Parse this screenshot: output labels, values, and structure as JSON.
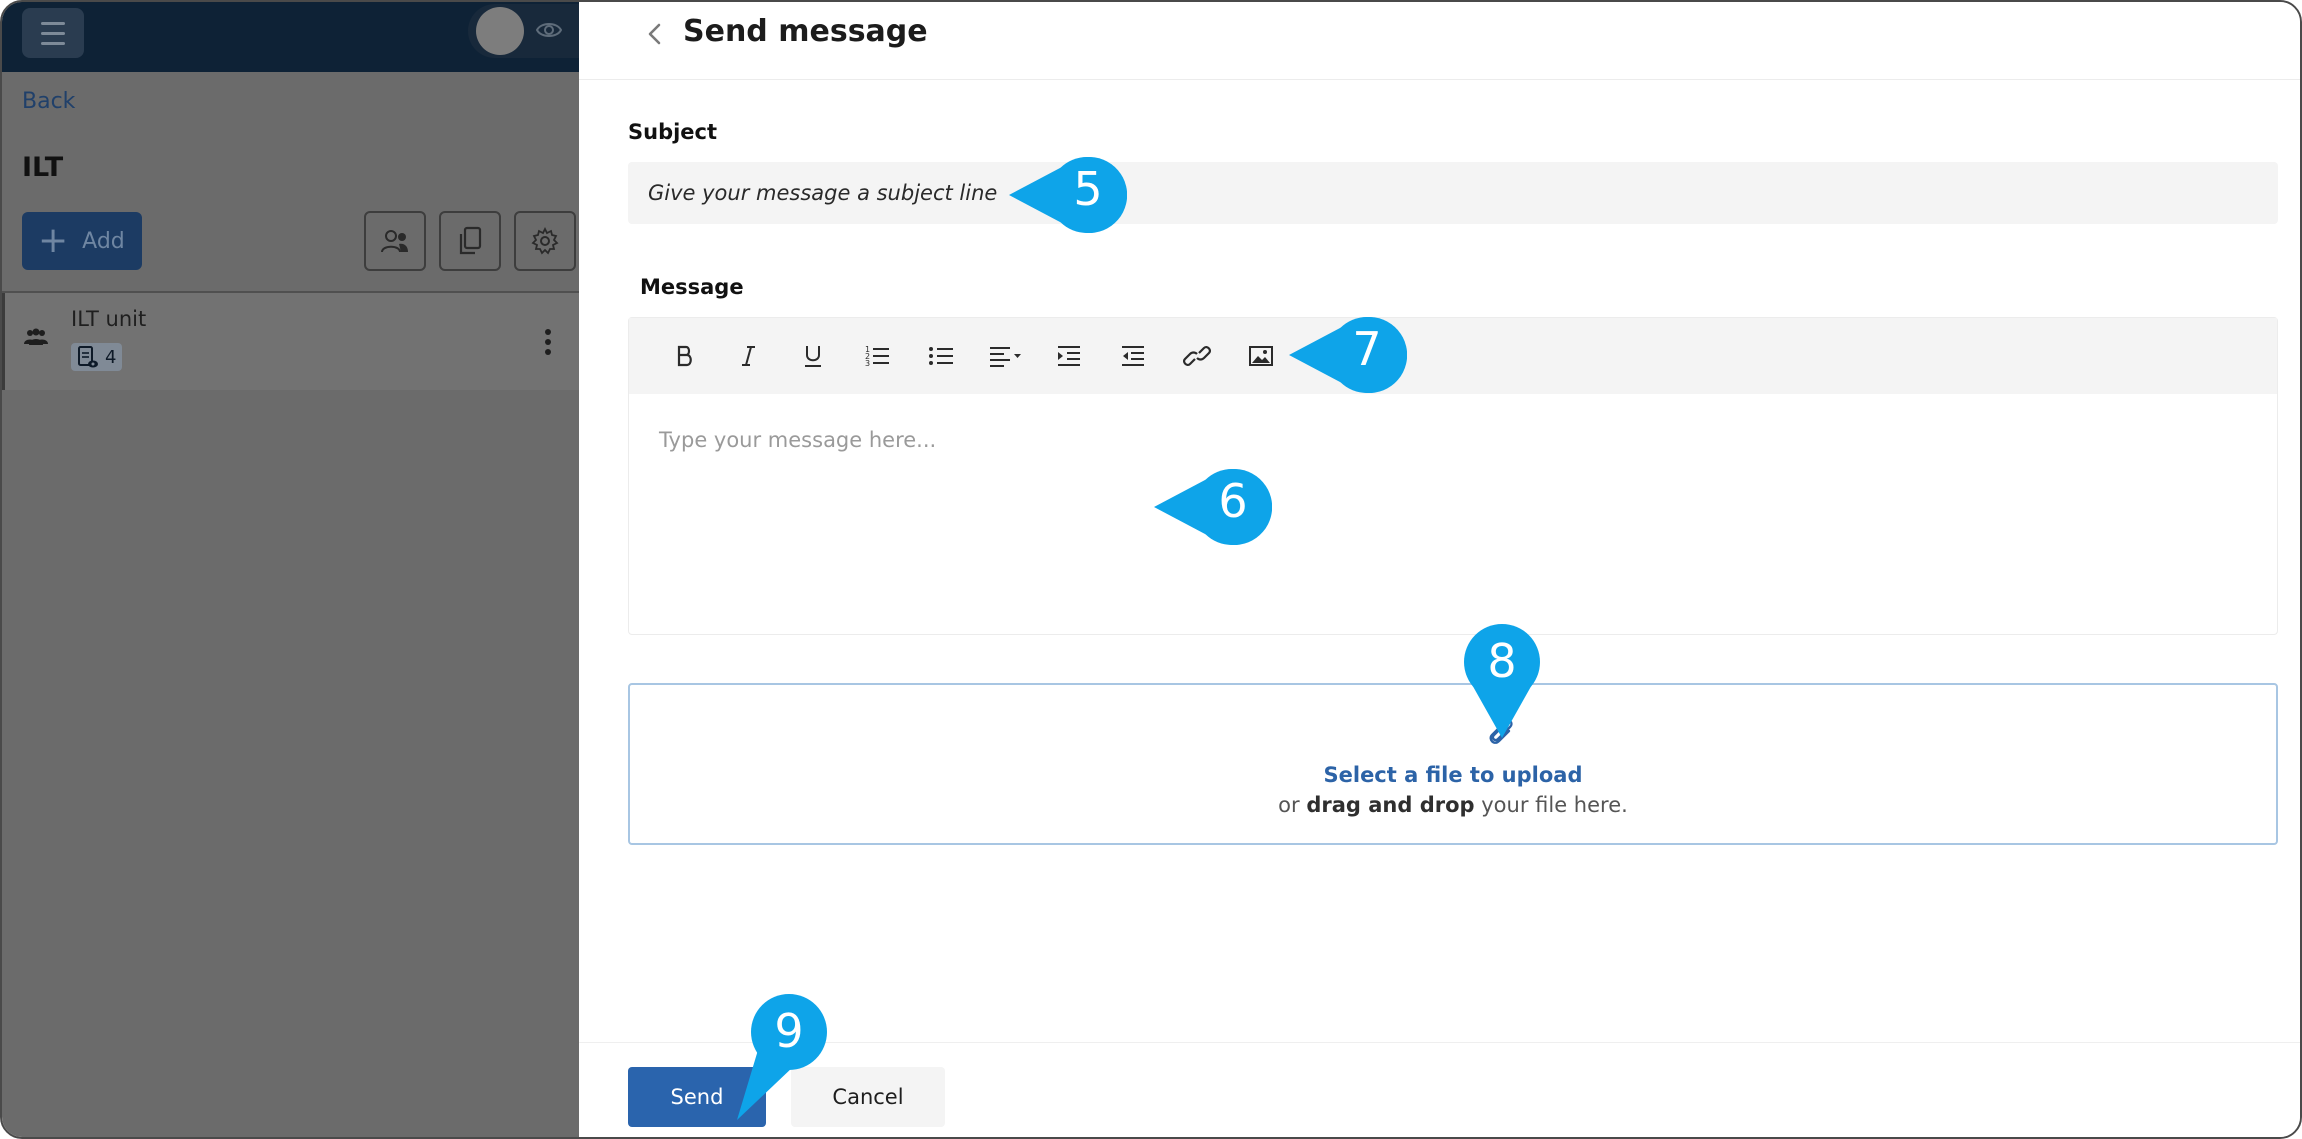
{
  "left_panel": {
    "back_label": "Back",
    "title": "ILT",
    "add_label": "Add",
    "unit": {
      "name": "ILT unit",
      "badge_count": "4"
    }
  },
  "header": {
    "title": "Send message"
  },
  "form": {
    "subject_label": "Subject",
    "subject_placeholder": "Give your message a subject line",
    "message_label": "Message",
    "message_placeholder": "Type your message here...",
    "toolbar": [
      "bold-icon",
      "italic-icon",
      "underline-icon",
      "ordered-list-icon",
      "bullet-list-icon",
      "align-icon",
      "indent-icon",
      "outdent-icon",
      "link-icon",
      "image-icon"
    ]
  },
  "upload": {
    "link_label": "Select a file to upload",
    "sub_prefix": "or",
    "sub_bold": "drag and drop",
    "sub_suffix": "your file here."
  },
  "footer": {
    "send_label": "Send",
    "cancel_label": "Cancel"
  },
  "callouts": {
    "c5": "5",
    "c6": "6",
    "c7": "7",
    "c8": "8",
    "c9": "9"
  },
  "colors": {
    "accent": "#2a64ad",
    "callout": "#0ea4e9",
    "overlay_topbar": "#0e2236"
  }
}
